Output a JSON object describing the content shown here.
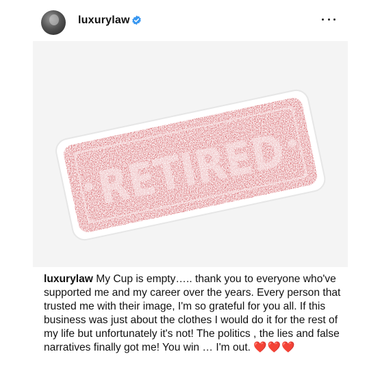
{
  "post": {
    "username": "luxurylaw",
    "verified": true,
    "avatar_icon": "profile-photo",
    "more_icon": "more-options-icon"
  },
  "image": {
    "stamp_text": "RETIRED",
    "colors": {
      "stamp_red": "#c4262e",
      "background": "#f4f4f4"
    }
  },
  "caption": {
    "username": "luxurylaw",
    "text": "My Cup is empty….. thank you to everyone who've supported me and my career over the years. Every person that trusted me with their image, I'm so grateful for you all. If this business was just about the clothes I would do it for the rest of my life but unfortunately it's not! The politics , the lies and false narratives  finally got me! You win … I'm out.",
    "emoji": "❤️❤️❤️"
  }
}
